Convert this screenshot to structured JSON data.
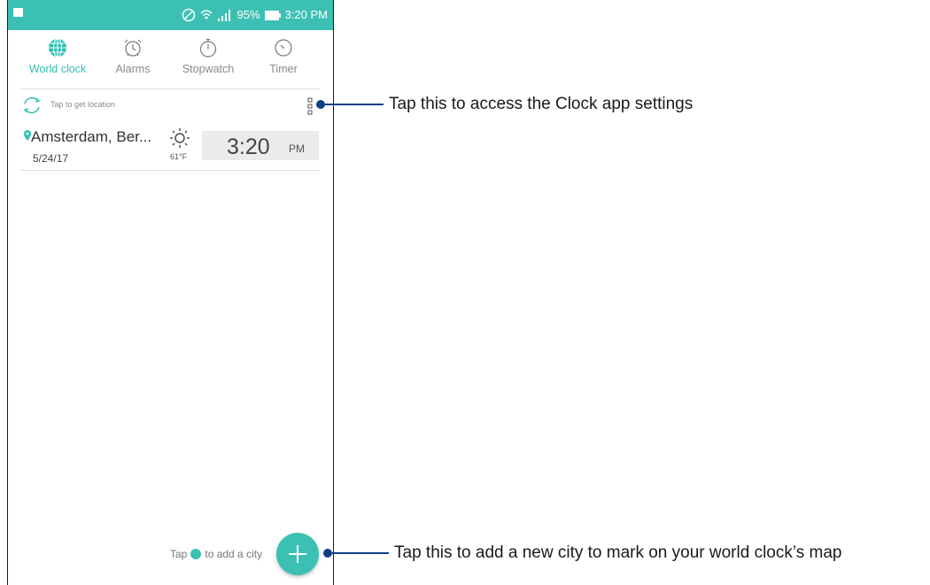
{
  "status_bar": {
    "battery": "95%",
    "time": "3:20 PM",
    "color": "#3cc0b4"
  },
  "tabs": [
    {
      "label": "World clock",
      "icon": "globe-icon",
      "active": true
    },
    {
      "label": "Alarms",
      "icon": "alarm-clock-icon",
      "active": false
    },
    {
      "label": "Stopwatch",
      "icon": "stopwatch-icon",
      "active": false
    },
    {
      "label": "Timer",
      "icon": "timer-icon",
      "active": false
    }
  ],
  "location": {
    "hint": "Tap to get location"
  },
  "city": {
    "name": "Amsterdam, Ber...",
    "date": "5/24/17",
    "temperature": "61°F",
    "time": "3:20",
    "ampm": "PM"
  },
  "footer": {
    "hint_before": "Tap",
    "hint_after": "to add a city"
  },
  "callouts": {
    "settings": "Tap this to access the Clock app settings",
    "add_city": "Tap this to add a new city to mark on your world clock’s map"
  },
  "colors": {
    "accent": "#3cc0b4",
    "callout": "#0d3f87"
  }
}
